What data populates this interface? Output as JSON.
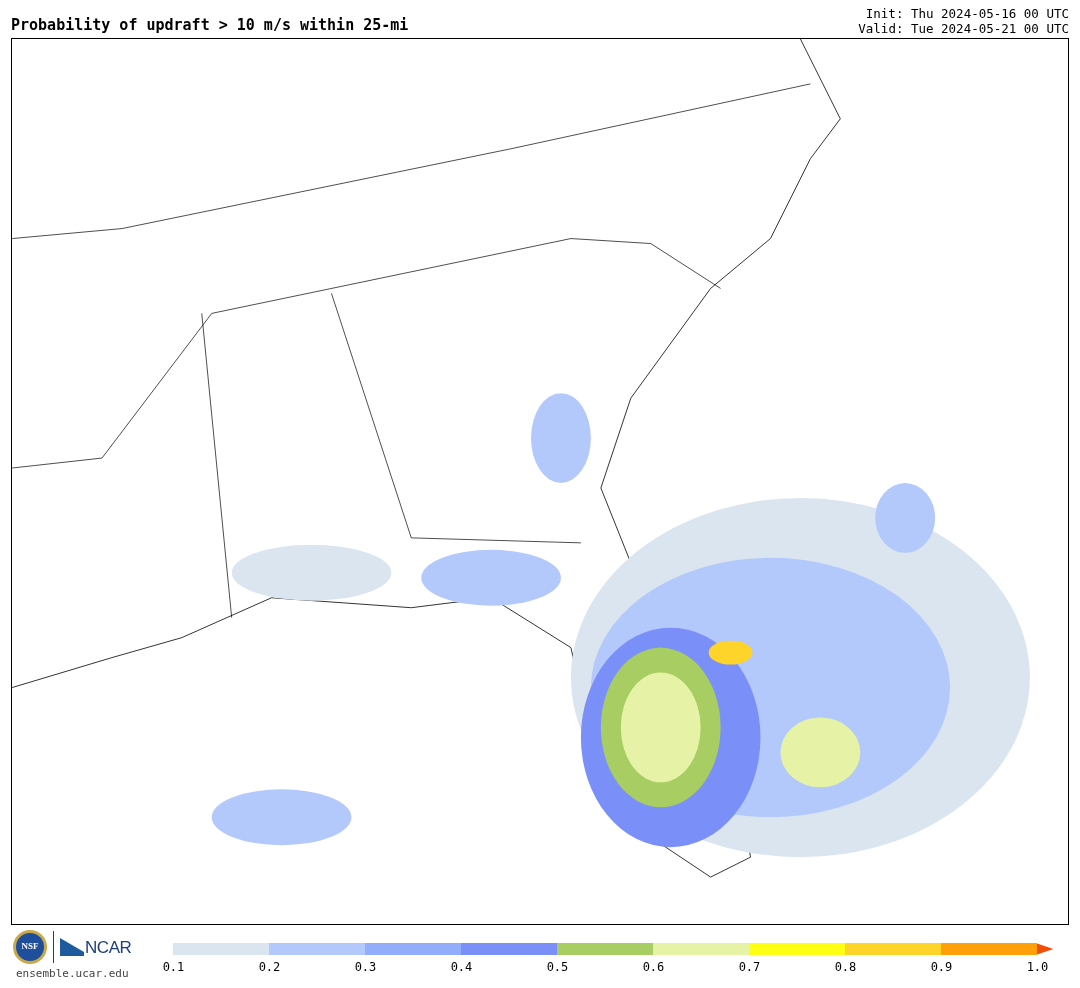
{
  "title": "Probability of updraft > 10 m/s within 25-mi",
  "init": "Init: Thu 2024-05-16 00 UTC",
  "valid": "Valid: Tue 2024-05-21 00 UTC",
  "logos": {
    "nsf": "NSF",
    "ncar": "NCAR"
  },
  "site": "ensemble.ucar.edu",
  "colorbar": {
    "segments": [
      {
        "color": "#dbe5ef"
      },
      {
        "color": "#b3c8fb"
      },
      {
        "color": "#92aefb"
      },
      {
        "color": "#7b8ff8"
      },
      {
        "color": "#a8cd63"
      },
      {
        "color": "#e6f3a6"
      },
      {
        "color": "#ffff14"
      },
      {
        "color": "#ffd42a"
      },
      {
        "color": "#ff9f0a"
      },
      {
        "kind": "arrow",
        "color": "#f04e0a"
      }
    ],
    "ticks": [
      "0.1",
      "0.2",
      "0.3",
      "0.4",
      "0.5",
      "0.6",
      "0.7",
      "0.8",
      "0.9",
      "1.0"
    ]
  }
}
